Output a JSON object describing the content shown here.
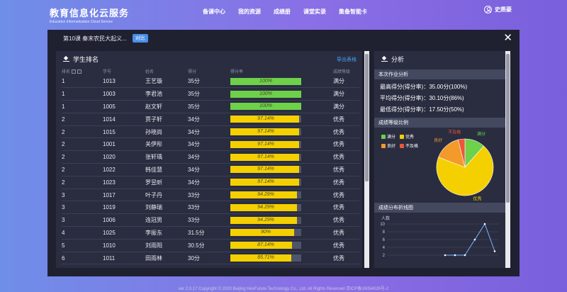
{
  "brand": {
    "title": "教育信息化云服务",
    "subtitle": "Education Informatization Cloud Service"
  },
  "nav": [
    "备课中心",
    "我的资源",
    "成绩册",
    "课堂实录",
    "集备智能卡"
  ],
  "user": {
    "name": "史燕豪"
  },
  "modal": {
    "lesson_title": "第10课 秦末农民大起义...",
    "contrast_label": "对比"
  },
  "ranking": {
    "title": "学生排名",
    "export_label": "导出表格",
    "columns": [
      "排名",
      "学号",
      "姓名",
      "得分",
      "得分率",
      "成绩等级"
    ],
    "rows": [
      {
        "rank": "1",
        "id": "1013",
        "name": "王艺璇",
        "score": "35分",
        "rate": "100%",
        "rate_value": 100,
        "grade": "满分"
      },
      {
        "rank": "1",
        "id": "1003",
        "name": "李君池",
        "score": "35分",
        "rate": "100%",
        "rate_value": 100,
        "grade": "满分"
      },
      {
        "rank": "1",
        "id": "1005",
        "name": "赵文轩",
        "score": "35分",
        "rate": "100%",
        "rate_value": 100,
        "grade": "满分"
      },
      {
        "rank": "2",
        "id": "1014",
        "name": "贾子轩",
        "score": "34分",
        "rate": "97.14%",
        "rate_value": 97.14,
        "grade": "优秀"
      },
      {
        "rank": "2",
        "id": "1015",
        "name": "孙晓尚",
        "score": "34分",
        "rate": "97.14%",
        "rate_value": 97.14,
        "grade": "优秀"
      },
      {
        "rank": "2",
        "id": "1001",
        "name": "关伊彤",
        "score": "34分",
        "rate": "97.14%",
        "rate_value": 97.14,
        "grade": "优秀"
      },
      {
        "rank": "2",
        "id": "1020",
        "name": "张轩瑀",
        "score": "34分",
        "rate": "97.14%",
        "rate_value": 97.14,
        "grade": "优秀"
      },
      {
        "rank": "2",
        "id": "1022",
        "name": "韩佳慧",
        "score": "34分",
        "rate": "97.14%",
        "rate_value": 97.14,
        "grade": "优秀"
      },
      {
        "rank": "2",
        "id": "1023",
        "name": "罗昱昕",
        "score": "34分",
        "rate": "97.14%",
        "rate_value": 97.14,
        "grade": "优秀"
      },
      {
        "rank": "3",
        "id": "1017",
        "name": "叶子丹",
        "score": "33分",
        "rate": "94.29%",
        "rate_value": 94.29,
        "grade": "优秀"
      },
      {
        "rank": "3",
        "id": "1019",
        "name": "刘静瑞",
        "score": "33分",
        "rate": "94.29%",
        "rate_value": 94.29,
        "grade": "优秀"
      },
      {
        "rank": "3",
        "id": "1006",
        "name": "连冠男",
        "score": "33分",
        "rate": "94.29%",
        "rate_value": 94.29,
        "grade": "优秀"
      },
      {
        "rank": "4",
        "id": "1025",
        "name": "李振东",
        "score": "31.5分",
        "rate": "90%",
        "rate_value": 90,
        "grade": "优秀"
      },
      {
        "rank": "5",
        "id": "1010",
        "name": "刘雨阳",
        "score": "30.5分",
        "rate": "87.14%",
        "rate_value": 87.14,
        "grade": "优秀"
      },
      {
        "rank": "6",
        "id": "1011",
        "name": "田雨林",
        "score": "30分",
        "rate": "85.71%",
        "rate_value": 85.71,
        "grade": "优秀"
      }
    ]
  },
  "analysis": {
    "title": "分析",
    "summary_head": "本次作业分析",
    "stats": [
      "最高得分(得分率)：35.00分(100%)",
      "平均得分(得分率)：30.10分(86%)",
      "最低得分(得分率)：17.50分(50%)"
    ],
    "pie_head": "成绩等级比例",
    "line_head": "成绩分布折线图",
    "line_ylabel": "人数"
  },
  "colors": {
    "full": "#6dd14a",
    "excellent": "#f5d000",
    "good": "#f39a2a",
    "fail": "#f0553a",
    "line": "#7ab4ff"
  },
  "chart_data": [
    {
      "type": "pie",
      "title": "成绩等级比例",
      "categories": [
        "满分",
        "优秀",
        "良好",
        "不及格"
      ],
      "values": [
        3,
        18,
        4,
        1
      ],
      "legend": "top-left"
    },
    {
      "type": "line",
      "title": "成绩分布折线图",
      "ylabel": "人数",
      "yticks": [
        10,
        8,
        6,
        4,
        2
      ],
      "ylim": [
        2,
        10
      ],
      "values": [
        2,
        2,
        2,
        6,
        10,
        3
      ],
      "grid": true
    }
  ],
  "footer": "ver 2.0.17 Copyright © 2020 Beijing HexFuture Technology Co., Ltd. All Rights Reserved 京ICP备16054026号-2"
}
